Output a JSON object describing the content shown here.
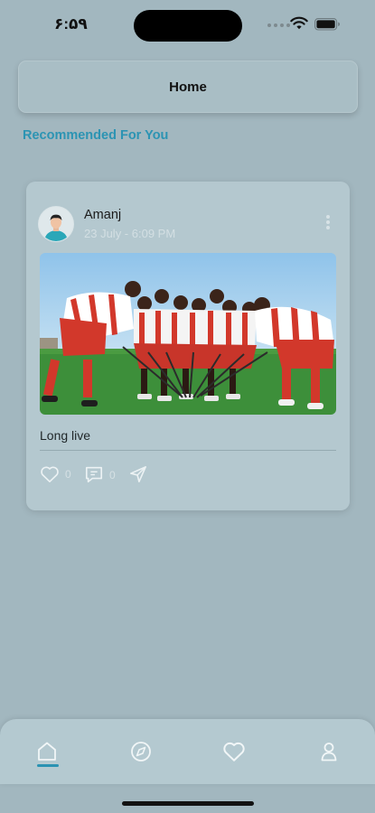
{
  "status_bar": {
    "time": "۶:۵۹",
    "icons": [
      "signal-dots-icon",
      "wifi-icon",
      "battery-icon"
    ]
  },
  "header": {
    "title": "Home"
  },
  "section": {
    "title": "Recommended For You"
  },
  "post": {
    "author": "Amanj",
    "time": "23 July - 6:09 PM",
    "text": "Long live",
    "likes": "0",
    "comments": "0",
    "image_icon": "team-photo"
  },
  "nav": {
    "items": [
      {
        "name": "home",
        "icon": "home-icon",
        "active": true
      },
      {
        "name": "explore",
        "icon": "compass-icon",
        "active": false
      },
      {
        "name": "likes",
        "icon": "heart-icon",
        "active": false
      },
      {
        "name": "profile",
        "icon": "user-icon",
        "active": false
      }
    ]
  },
  "colors": {
    "background": "#a2b7bf",
    "accent": "#2c94b3",
    "card": "#b4c8cf"
  }
}
